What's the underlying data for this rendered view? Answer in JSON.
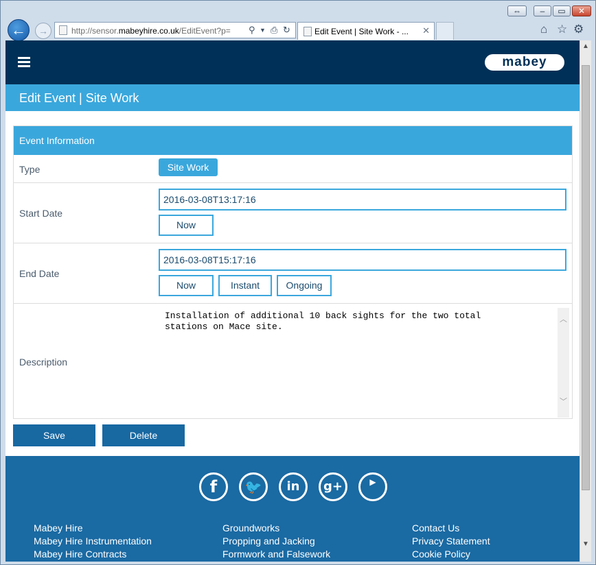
{
  "browser": {
    "address": {
      "prefix": "http://sensor.",
      "domain": "mabeyhire.co.uk",
      "path": "/EditEvent?p="
    },
    "tab": {
      "title": "Edit Event | Site Work - ...",
      "close_glyph": "✕"
    }
  },
  "site": {
    "logo_text": "mabey",
    "page_title": "Edit Event | Site Work"
  },
  "form": {
    "header": "Event Information",
    "type": {
      "label": "Type",
      "value": "Site Work"
    },
    "start_date": {
      "label": "Start Date",
      "value": "2016-03-08T13:17:16",
      "now_label": "Now"
    },
    "end_date": {
      "label": "End Date",
      "value": "2016-03-08T15:17:16",
      "now_label": "Now",
      "instant_label": "Instant",
      "ongoing_label": "Ongoing"
    },
    "description": {
      "label": "Description",
      "value": "Installation of additional 10 back sights for the two total\nstations on Mace site."
    }
  },
  "actions": {
    "save_label": "Save",
    "delete_label": "Delete"
  },
  "footer": {
    "social": [
      "facebook-icon",
      "twitter-icon",
      "linkedin-icon",
      "google-plus-icon",
      "youtube-icon"
    ],
    "col1": [
      "Mabey Hire",
      "Mabey Hire Instrumentation",
      "Mabey Hire Contracts"
    ],
    "col2": [
      "Groundworks",
      "Propping and Jacking",
      "Formwork and Falsework"
    ],
    "col3": [
      "Contact Us",
      "Privacy Statement",
      "Cookie Policy"
    ]
  },
  "colors": {
    "header_navy": "#003057",
    "accent_blue": "#3aa7dc",
    "button_blue": "#1868a2",
    "footer_blue": "#1a6aa3"
  }
}
